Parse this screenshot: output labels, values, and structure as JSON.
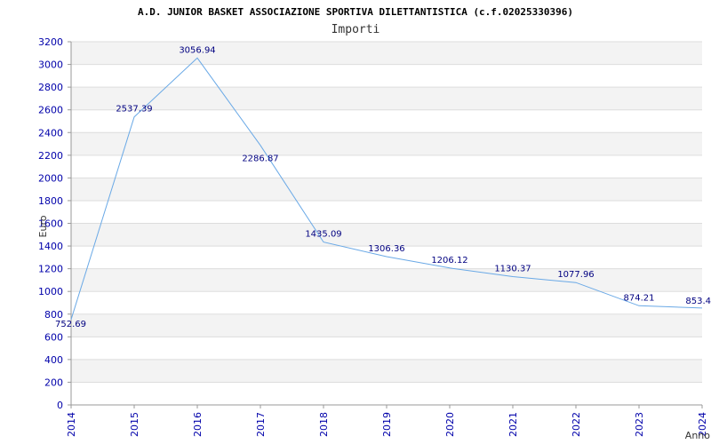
{
  "chart_data": {
    "type": "line",
    "title": "A.D. JUNIOR BASKET ASSOCIAZIONE SPORTIVA DILETTANTISTICA (c.f.02025330396)",
    "subtitle": "Importi",
    "xlabel": "Anno",
    "ylabel": "Euro",
    "x": [
      "2014",
      "2015",
      "2016",
      "2017",
      "2018",
      "2019",
      "2020",
      "2021",
      "2022",
      "2023",
      "2024"
    ],
    "values": [
      752.69,
      2537.39,
      3056.94,
      2286.87,
      1435.09,
      1306.36,
      1206.12,
      1130.37,
      1077.96,
      874.21,
      853.4
    ],
    "data_labels": [
      "752.69",
      "2537.39",
      "3056.94",
      "2286.87",
      "1435.09",
      "1306.36",
      "1206.12",
      "1130.37",
      "1077.96",
      "874.21",
      "853.4"
    ],
    "ylim": [
      0,
      3200
    ],
    "yticks": [
      0,
      200,
      400,
      600,
      800,
      1000,
      1200,
      1400,
      1600,
      1800,
      2000,
      2200,
      2400,
      2600,
      2800,
      3000,
      3200
    ],
    "grid": true,
    "line_color": "#6aa9e6",
    "band_color": "#f3f3f3",
    "tick_color": "#0000aa",
    "label_color": "#000080"
  }
}
